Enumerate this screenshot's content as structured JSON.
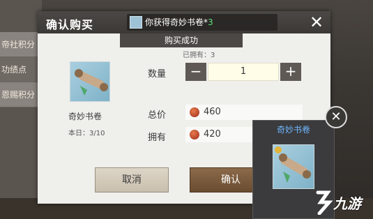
{
  "background": {
    "left_rows": [
      "帝社积分",
      "功绩点",
      "恩赐积分"
    ]
  },
  "dialog": {
    "title": "确认购买",
    "close_icon": "close-icon",
    "toast": {
      "text": "你获得奇妙书卷*",
      "count": "3"
    },
    "subtitle": "购买成功",
    "owned_note": "已拥有：3",
    "item": {
      "name": "奇妙书卷",
      "daily_limit": "本日：3/10",
      "icon": "scroll-icon"
    },
    "quantity": {
      "label": "数量",
      "minus": "−",
      "plus": "+",
      "value": "1"
    },
    "total": {
      "label": "总价",
      "value": "460"
    },
    "owned": {
      "label": "拥有",
      "value": "420"
    },
    "buttons": {
      "cancel": "取消",
      "confirm": "确认"
    }
  },
  "tooltip": {
    "title": "奇妙书卷",
    "close": "✕"
  },
  "watermark": {
    "text": "九游"
  }
}
